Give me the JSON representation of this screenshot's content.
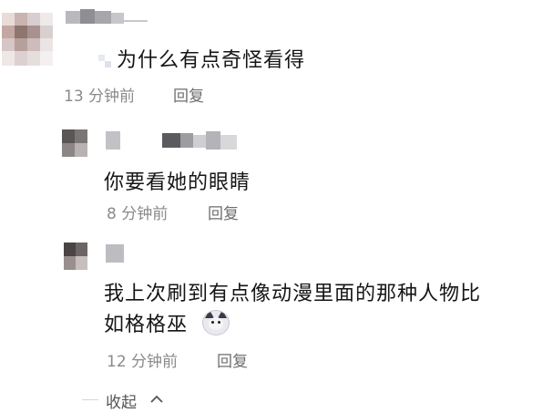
{
  "comments": [
    {
      "text": "为什么有点奇怪看得",
      "time": "13 分钟前",
      "reply_label": "回复",
      "replies": [
        {
          "text": "你要看她的眼睛",
          "time": "8 分钟前",
          "reply_label": "回复"
        },
        {
          "text_line1": "我上次刷到有点像动漫里面的那种人物比",
          "text_line2": "如格格巫",
          "emoji": "cat-face-emoji",
          "time": "12 分钟前",
          "reply_label": "回复"
        }
      ]
    }
  ],
  "collapse_label": "收起",
  "collapse_icon": "chevron-up-icon"
}
